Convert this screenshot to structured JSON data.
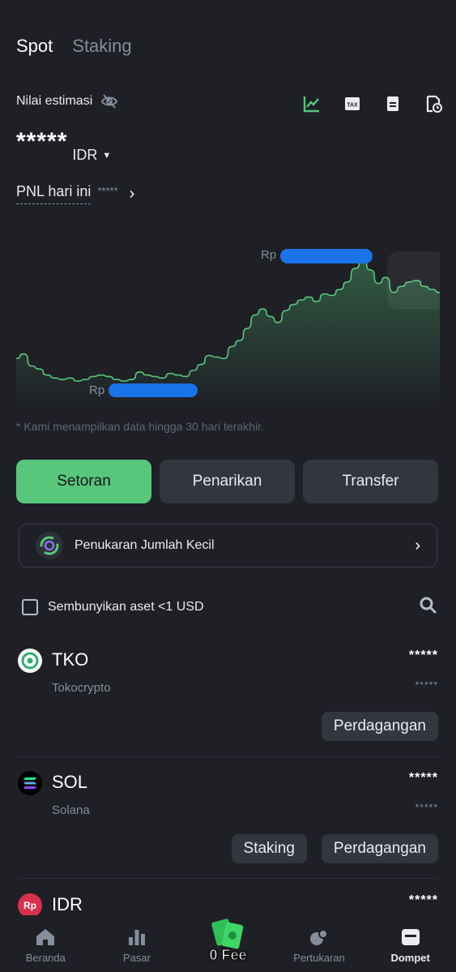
{
  "tabs": [
    {
      "label": "Spot",
      "active": true
    },
    {
      "label": "Staking",
      "active": false
    }
  ],
  "estimate": {
    "label": "Nilai estimasi",
    "balance": "*****",
    "currency": "IDR"
  },
  "pnl": {
    "label": "PNL hari ini",
    "value": "*****"
  },
  "chart_data": {
    "type": "area",
    "annotations": [
      "Rp",
      "Rp"
    ],
    "line_color": "#58c77b",
    "values": [
      32,
      35,
      27,
      25,
      21,
      19,
      18,
      19,
      17,
      18,
      20,
      21,
      20,
      18,
      17,
      18,
      23,
      21,
      20,
      19,
      22,
      21,
      20,
      24,
      28,
      34,
      33,
      32,
      40,
      44,
      52,
      61,
      65,
      60,
      56,
      64,
      68,
      71,
      73,
      70,
      75,
      74,
      78,
      83,
      92,
      98,
      91,
      82,
      86,
      76,
      80,
      83,
      84,
      80,
      78,
      76
    ]
  },
  "chart_note": "* Kami menampilkan data hingga 30 hari terakhir.",
  "actions": {
    "deposit": "Setoran",
    "withdraw": "Penarikan",
    "transfer": "Transfer"
  },
  "small_exchange": {
    "label": "Penukaran Jumlah Kecil"
  },
  "hide_small": {
    "label": "Sembunyikan aset <1 USD"
  },
  "assets": [
    {
      "symbol": "TKO",
      "name": "Tokocrypto",
      "amount": "*****",
      "sub": "*****",
      "icon_color": "#ffffff",
      "actions": [
        "Perdagangan"
      ]
    },
    {
      "symbol": "SOL",
      "name": "Solana",
      "amount": "*****",
      "sub": "*****",
      "icon_color": "#000000",
      "actions": [
        "Staking",
        "Perdagangan"
      ]
    },
    {
      "symbol": "IDR",
      "name": "",
      "amount": "*****",
      "sub": "",
      "icon_color": "#d9304e",
      "icon_text": "Rp",
      "actions": []
    }
  ],
  "nav": {
    "home": "Beranda",
    "market": "Pasar",
    "fee": "0 Fee",
    "trade": "Pertukaran",
    "wallet": "Dompet"
  },
  "colors": {
    "accent": "#58c77b",
    "background": "#1e2026",
    "surface": "#32363e",
    "muted": "#848e9c"
  }
}
